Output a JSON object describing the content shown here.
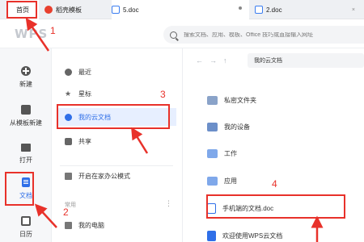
{
  "tabs": {
    "home": "首页",
    "templates": "稻壳模板",
    "doc5": "5.doc",
    "doc2": "2.doc",
    "close_glyph": "×"
  },
  "search": {
    "placeholder": "搜索文档、应用、模板、Office 技巧或直接输入网址"
  },
  "logo": "WPS",
  "rail": [
    {
      "label": "新建",
      "icon": "plus-circle-icon"
    },
    {
      "label": "从模板新建",
      "icon": "template-icon"
    },
    {
      "label": "打开",
      "icon": "folder-open-icon"
    },
    {
      "label": "文档",
      "icon": "document-icon"
    },
    {
      "label": "日历",
      "icon": "calendar-icon"
    }
  ],
  "nav": {
    "recent": "最近",
    "starred": "星标",
    "my_cloud_docs": "我的云文档",
    "shared": "共享",
    "office_mode": "开启在家办公模式",
    "group_common": "常用",
    "my_computer": "我的电脑",
    "more_glyph": "⋮"
  },
  "toolbar": {
    "back": "←",
    "forward": "→",
    "up": "↑",
    "breadcrumb": "我的云文档"
  },
  "files": [
    {
      "name": "私密文件夹",
      "icon": "lock-folder-icon"
    },
    {
      "name": "我的设备",
      "icon": "device-folder-icon"
    },
    {
      "name": "工作",
      "icon": "folder-icon"
    },
    {
      "name": "应用",
      "icon": "folder-icon"
    },
    {
      "name": "手机端的文档.doc",
      "icon": "doc-file-icon"
    },
    {
      "name": "欢迎使用WPS云文档",
      "icon": "doc-file-icon"
    }
  ],
  "annotations": {
    "n1": "1",
    "n2": "2",
    "n3": "3",
    "n4": "4"
  },
  "colors": {
    "accent": "#2f6fe8",
    "annotation_red": "#e8312a"
  }
}
